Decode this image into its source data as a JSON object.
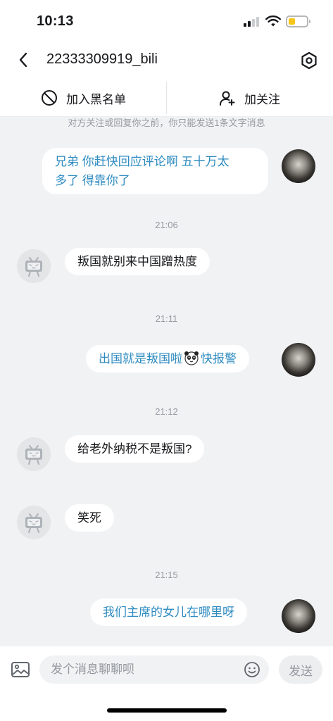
{
  "status_bar": {
    "time": "10:13",
    "battery_color": "#f5c518"
  },
  "header": {
    "title": "22333309919_bili",
    "back_icon": "chevron-left-icon",
    "settings_icon": "settings-hexagon-icon"
  },
  "actions": {
    "block_label": "加入黑名单",
    "follow_label": "加关注"
  },
  "chat": {
    "notice": "对方关注或回复你之前，你只能发送1条文字消息",
    "messages": [
      {
        "sender": "self",
        "text_lines": [
          "兄弟 你赶快回应评论啊 五十万太",
          "多了 得靠你了"
        ]
      },
      {
        "time": "21:06"
      },
      {
        "sender": "other",
        "text": "叛国就别来中国蹭热度"
      },
      {
        "time": "21:11"
      },
      {
        "sender": "self",
        "text_before": "出国就是叛国啦",
        "emoji": "panda-emoji",
        "text_after": "快报警"
      },
      {
        "time": "21:12"
      },
      {
        "sender": "other",
        "text": "给老外纳税不是叛国?"
      },
      {
        "sender": "other",
        "text": "笑死"
      },
      {
        "time": "21:15"
      },
      {
        "sender": "self",
        "text": "我们主席的女儿在哪里呀"
      }
    ]
  },
  "input": {
    "placeholder": "发个消息聊聊呗",
    "value": "",
    "send_label": "发送"
  },
  "colors": {
    "self_text": "#2e8bc0",
    "chat_background": "#f1f2f3",
    "muted": "#9499a0"
  }
}
